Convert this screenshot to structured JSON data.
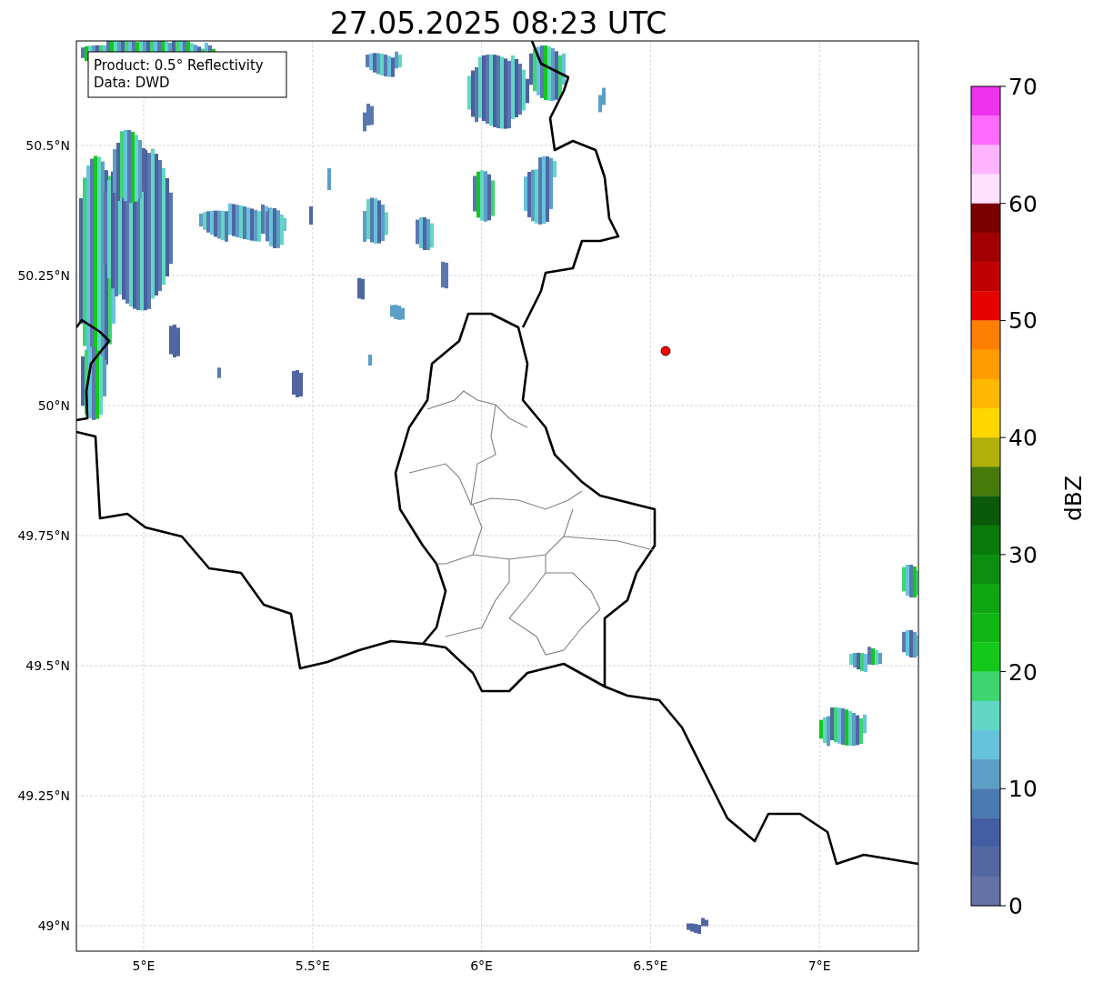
{
  "title": "27.05.2025 08:23 UTC",
  "map": {
    "info_box": [
      "Product: 0.5° Reflectivity",
      "Data: DWD"
    ],
    "xticks": [
      "5°E",
      "5.5°E",
      "6°E",
      "6.5°E",
      "7°E"
    ],
    "yticks": [
      "50.5°N",
      "50.25°N",
      "50°N",
      "49.75°N",
      "49.5°N",
      "49.25°N",
      "49°N"
    ]
  },
  "colorbar": {
    "label": "dBZ",
    "ticks": [
      "70",
      "60",
      "50",
      "40",
      "30",
      "20",
      "10",
      "0"
    ],
    "bins": [
      {
        "color": "#ee33ee"
      },
      {
        "color": "#ff6aff"
      },
      {
        "color": "#ffb4ff"
      },
      {
        "color": "#ffe0ff"
      },
      {
        "color": "#7a0000"
      },
      {
        "color": "#a00000"
      },
      {
        "color": "#c00000"
      },
      {
        "color": "#e60000"
      },
      {
        "color": "#ff7f00"
      },
      {
        "color": "#ff9c00"
      },
      {
        "color": "#ffb800"
      },
      {
        "color": "#ffd700"
      },
      {
        "color": "#b0b006"
      },
      {
        "color": "#477a0b"
      },
      {
        "color": "#0a5a0a"
      },
      {
        "color": "#0b7a0e"
      },
      {
        "color": "#0e8e11"
      },
      {
        "color": "#0fa513"
      },
      {
        "color": "#11b614"
      },
      {
        "color": "#13c81b"
      },
      {
        "color": "#3ed570"
      },
      {
        "color": "#62d6c4"
      },
      {
        "color": "#66c3dc"
      },
      {
        "color": "#5c9ec6"
      },
      {
        "color": "#4a7ab2"
      },
      {
        "color": "#445ea3"
      },
      {
        "color": "#5367a0"
      },
      {
        "color": "#6473a5"
      }
    ]
  }
}
